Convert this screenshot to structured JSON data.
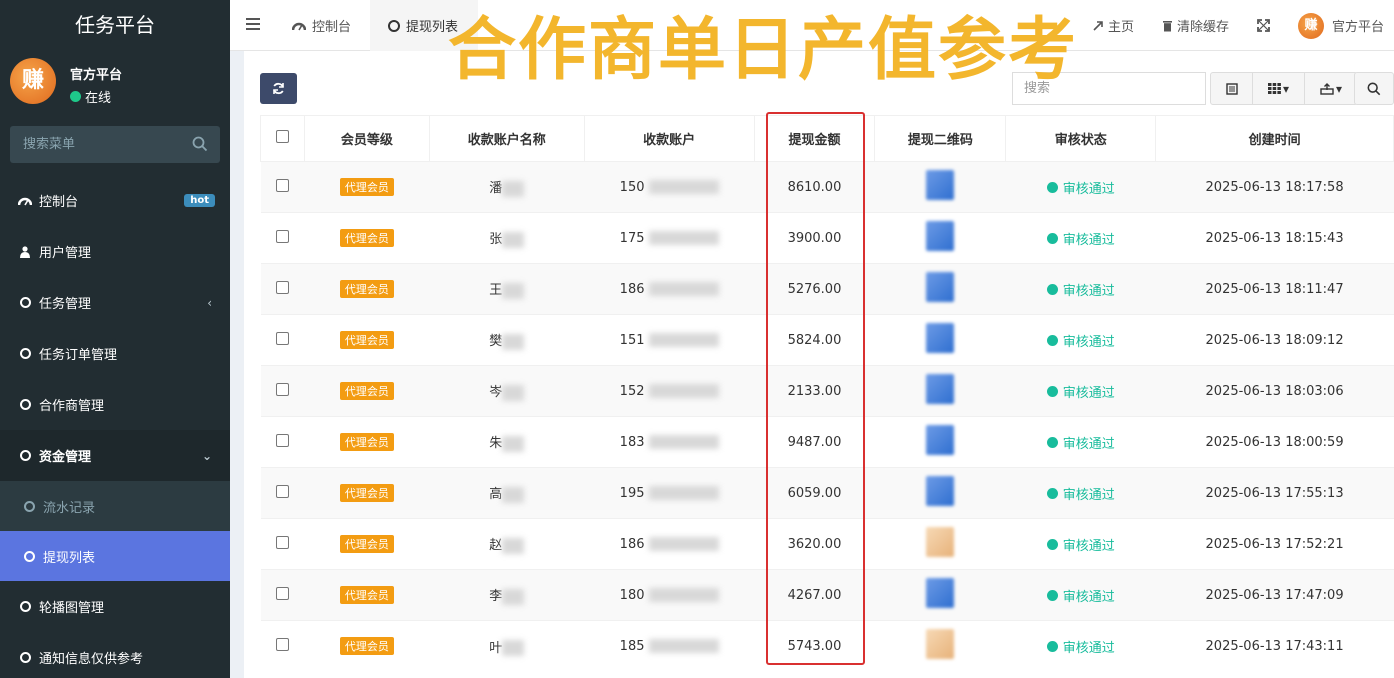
{
  "brand": {
    "title": "任务平台"
  },
  "user": {
    "name": "官方平台",
    "status": "在线",
    "avatar_char": "赚"
  },
  "sidebar": {
    "search_placeholder": "搜索菜单",
    "items": [
      {
        "label": "控制台",
        "badge": "hot",
        "icon": "dashboard-icon"
      },
      {
        "label": "用户管理",
        "icon": "user-icon"
      },
      {
        "label": "任务管理",
        "icon": "circle-icon"
      },
      {
        "label": "任务订单管理",
        "icon": "circle-icon"
      },
      {
        "label": "合作商管理",
        "icon": "circle-icon"
      },
      {
        "label": "资金管理",
        "icon": "circle-icon"
      },
      {
        "label": "流水记录",
        "icon": "circle-icon"
      },
      {
        "label": "提现列表",
        "icon": "circle-icon"
      },
      {
        "label": "轮播图管理",
        "icon": "circle-icon"
      },
      {
        "label": "通知信息仅供参考",
        "icon": "circle-icon"
      }
    ]
  },
  "topnav": {
    "tabs": [
      {
        "label": "控制台"
      },
      {
        "label": "提现列表"
      }
    ],
    "home_label": "主页",
    "clear_cache_label": "清除缓存",
    "user_label": "官方平台"
  },
  "overlay_title": "合作商单日产值参考",
  "toolbar": {
    "search_placeholder": "搜索"
  },
  "table": {
    "headers": [
      "会员等级",
      "收款账户名称",
      "收款账户",
      "提现金额",
      "提现二维码",
      "审核状态",
      "创建时间"
    ],
    "rows": [
      {
        "level": "代理会员",
        "name": "潘",
        "account": "150",
        "amount": "8610.00",
        "status": "审核通过",
        "time": "2025-06-13 18:17:58"
      },
      {
        "level": "代理会员",
        "name": "张",
        "account": "175",
        "amount": "3900.00",
        "status": "审核通过",
        "time": "2025-06-13 18:15:43"
      },
      {
        "level": "代理会员",
        "name": "王",
        "account": "186",
        "amount": "5276.00",
        "status": "审核通过",
        "time": "2025-06-13 18:11:47"
      },
      {
        "level": "代理会员",
        "name": "樊",
        "account": "151",
        "amount": "5824.00",
        "status": "审核通过",
        "time": "2025-06-13 18:09:12"
      },
      {
        "level": "代理会员",
        "name": "岑",
        "account": "152",
        "amount": "2133.00",
        "status": "审核通过",
        "time": "2025-06-13 18:03:06"
      },
      {
        "level": "代理会员",
        "name": "朱",
        "account": "183",
        "amount": "9487.00",
        "status": "审核通过",
        "time": "2025-06-13 18:00:59"
      },
      {
        "level": "代理会员",
        "name": "高",
        "account": "195",
        "amount": "6059.00",
        "status": "审核通过",
        "time": "2025-06-13 17:55:13"
      },
      {
        "level": "代理会员",
        "name": "赵",
        "account": "186",
        "amount": "3620.00",
        "status": "审核通过",
        "time": "2025-06-13 17:52:21"
      },
      {
        "level": "代理会员",
        "name": "李",
        "account": "180",
        "amount": "4267.00",
        "status": "审核通过",
        "time": "2025-06-13 17:47:09"
      },
      {
        "level": "代理会员",
        "name": "叶",
        "account": "185",
        "amount": "5743.00",
        "status": "审核通过",
        "time": "2025-06-13 17:43:11"
      }
    ]
  },
  "colors": {
    "sidebar_bg": "#222d32",
    "active_item": "#5b75e0",
    "tag": "#f39c12",
    "status": "#18bc9c",
    "overlay": "#f3b62d",
    "highlight": "#d93030"
  }
}
